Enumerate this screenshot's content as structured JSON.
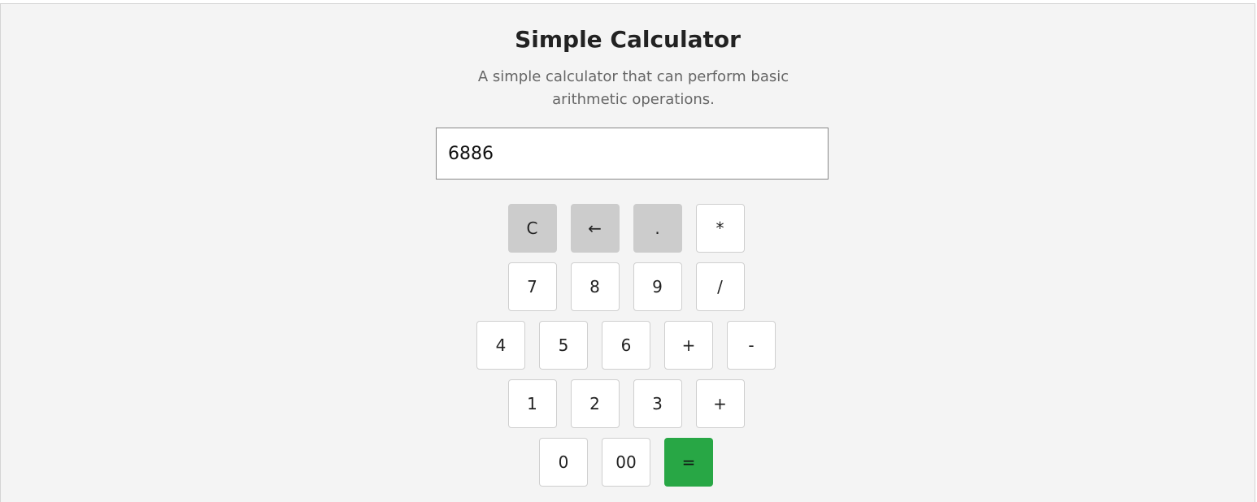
{
  "title": "Simple Calculator",
  "description": "A simple calculator that can perform basic arithmetic operations.",
  "display": {
    "value": "6886"
  },
  "colors": {
    "accent": "#28a745",
    "function_key": "#cccccc",
    "background": "#f4f4f4"
  },
  "keys": {
    "row1": [
      "C",
      "←",
      ".",
      "*"
    ],
    "row2": [
      "7",
      "8",
      "9",
      "/"
    ],
    "row3": [
      "4",
      "5",
      "6",
      "+",
      "-"
    ],
    "row4": [
      "1",
      "2",
      "3",
      "+"
    ],
    "row5": [
      "0",
      "00",
      "="
    ]
  }
}
